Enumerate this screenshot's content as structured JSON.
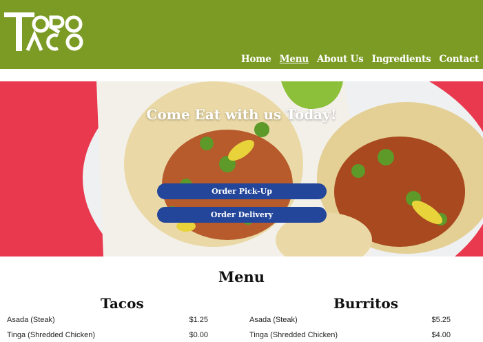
{
  "brand": {
    "logo_text": "TORO TACO"
  },
  "nav": {
    "items": [
      "Home",
      "Menu",
      "About Us",
      "Ingredients",
      "Contact"
    ],
    "active": "Menu"
  },
  "hero": {
    "title": "Come Eat with us Today!",
    "pickup_label": "Order Pick-Up",
    "delivery_label": "Order Delivery"
  },
  "menu": {
    "title": "Menu",
    "tacos": {
      "title": "Tacos",
      "items": [
        {
          "name": "Asada (Steak)",
          "price": "$1.25"
        },
        {
          "name": "Tinga (Shredded Chicken)",
          "price": "$0.00"
        }
      ]
    },
    "burritos": {
      "title": "Burritos",
      "items": [
        {
          "name": "Asada (Steak)",
          "price": "$5.25"
        },
        {
          "name": "Tinga (Shredded Chicken)",
          "price": "$4.00"
        }
      ]
    }
  },
  "colors": {
    "header_green": "#7b9b24",
    "button_blue": "#23459a",
    "hero_red": "#e8394e"
  }
}
